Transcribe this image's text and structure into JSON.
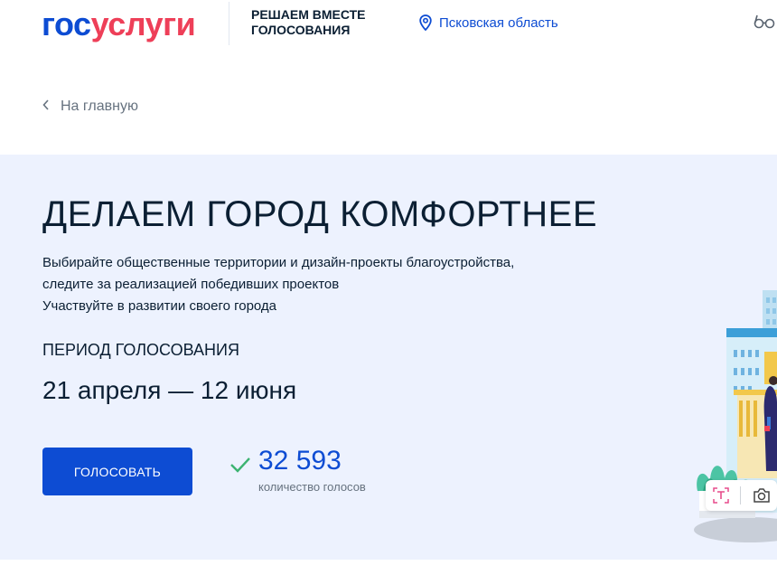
{
  "header": {
    "logo_part1": "гос",
    "logo_part2": "услуги",
    "project_line1": "РЕШАЕМ ВМЕСТЕ",
    "project_line2": "ГОЛОСОВАНИЯ",
    "region": "Псковская область",
    "region_icon": "location-pin-icon",
    "accessibility_icon": "glasses-icon",
    "brand_blue": "#0d4cd3",
    "brand_red": "#ee3f58"
  },
  "breadcrumb": {
    "back_label": "На главную",
    "icon": "chevron-left-icon"
  },
  "hero": {
    "title": "ДЕЛАЕМ ГОРОД КОМФОРТНЕЕ",
    "desc_line1": "Выбирайте общественные территории и дизайн-проекты благоустройства,",
    "desc_line2": "следите за реализацией победивших проектов",
    "desc_line3": "Участвуйте в развитии своего города",
    "period_label": "ПЕРИОД ГОЛОСОВАНИЯ",
    "period_value": "21 апреля — 12 июня",
    "vote_button": "ГОЛОСОВАТЬ",
    "votes_count": "32 593",
    "votes_caption": "количество голосов",
    "check_icon": "checkmark-icon",
    "background": "#edf2fe"
  },
  "toolbar": {
    "icons": [
      "text-select-icon",
      "camera-icon"
    ]
  }
}
